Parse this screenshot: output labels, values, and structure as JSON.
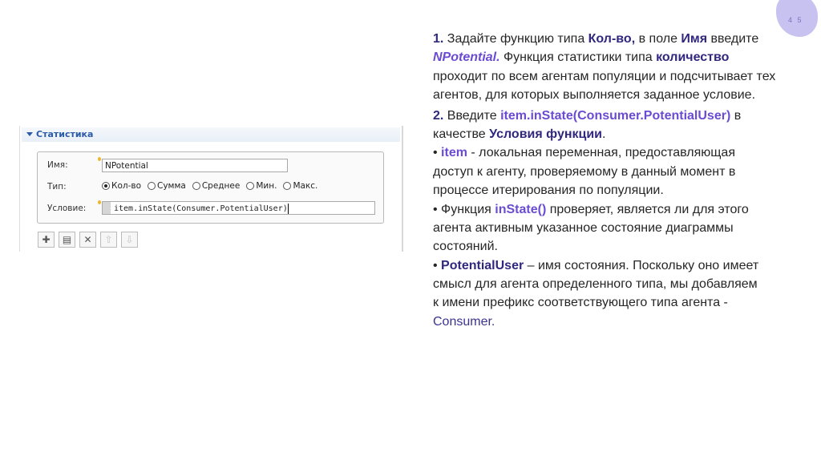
{
  "slide": {
    "page_number": "4 5"
  },
  "dialog": {
    "section_title": "Статистика",
    "name_label": "Имя:",
    "name_value": "NPotential",
    "type_label": "Тип:",
    "type_options": [
      {
        "label": "Кол-во",
        "selected": true
      },
      {
        "label": "Сумма",
        "selected": false
      },
      {
        "label": "Среднее",
        "selected": false
      },
      {
        "label": "Мин.",
        "selected": false
      },
      {
        "label": "Макс.",
        "selected": false
      }
    ],
    "condition_label": "Условие:",
    "condition_value": "item.inState(Consumer.PotentialUser)",
    "toolbar": [
      {
        "icon": "add-icon",
        "glyph": "✚",
        "enabled": true
      },
      {
        "icon": "paste-icon",
        "glyph": "▤",
        "enabled": true
      },
      {
        "icon": "delete-icon",
        "glyph": "✕",
        "enabled": true
      },
      {
        "icon": "move-up-icon",
        "glyph": "⇧",
        "enabled": false
      },
      {
        "icon": "move-down-icon",
        "glyph": "⇩",
        "enabled": false
      }
    ]
  },
  "instructions": {
    "lines": [
      [
        {
          "t": "1.",
          "s": "num"
        },
        {
          "t": " Задайте функцию типа ",
          "s": ""
        },
        {
          "t": "Кол-во,",
          "s": "term"
        },
        {
          "t": " в поле ",
          "s": ""
        },
        {
          "t": "Имя",
          "s": "term"
        },
        {
          "t": " введите",
          "s": ""
        }
      ],
      [
        {
          "t": "NPotential.",
          "s": "accentI"
        },
        {
          "t": " Функция статистики типа ",
          "s": ""
        },
        {
          "t": "количество",
          "s": "term"
        }
      ],
      [
        {
          "t": "проходит по всем агентам популяции и подсчитывает тех",
          "s": ""
        }
      ],
      [
        {
          "t": "агентов, для которых выполняется заданное условие.",
          "s": ""
        }
      ],
      [
        {
          "t": "2.",
          "s": "num"
        },
        {
          "t": " Введите ",
          "s": ""
        },
        {
          "t": "item.inState(Consumer.PotentialUser)",
          "s": "accent"
        },
        {
          "t": " в",
          "s": ""
        }
      ],
      [
        {
          "t": "качестве ",
          "s": ""
        },
        {
          "t": "Условия функции",
          "s": "term"
        },
        {
          "t": ".",
          "s": ""
        }
      ],
      [
        {
          "t": "• ",
          "s": ""
        },
        {
          "t": "item",
          "s": "accent"
        },
        {
          "t": " - локальная переменная, предоставляющая",
          "s": ""
        }
      ],
      [
        {
          "t": "доступ к агенту, проверяемому в данный момент в",
          "s": ""
        }
      ],
      [
        {
          "t": "процессе итерирования по популяции.",
          "s": ""
        }
      ],
      [
        {
          "t": "• Функция ",
          "s": ""
        },
        {
          "t": "inState()",
          "s": "accent"
        },
        {
          "t": " проверяет, является ли для этого",
          "s": ""
        }
      ],
      [
        {
          "t": "агента активным указанное состояние диаграммы",
          "s": ""
        }
      ],
      [
        {
          "t": "состояний.",
          "s": ""
        }
      ],
      [
        {
          "t": "• ",
          "s": ""
        },
        {
          "t": "PotentialUser",
          "s": "term"
        },
        {
          "t": " – имя состояния. Поскольку оно имеет",
          "s": ""
        }
      ],
      [
        {
          "t": "смысл для агента определенного типа, мы добавляем",
          "s": ""
        }
      ],
      [
        {
          "t": "к имени префикс соответствующего типа агента -",
          "s": ""
        }
      ],
      [
        {
          "t": "Consumer.",
          "s": "plain-accent"
        }
      ]
    ]
  }
}
